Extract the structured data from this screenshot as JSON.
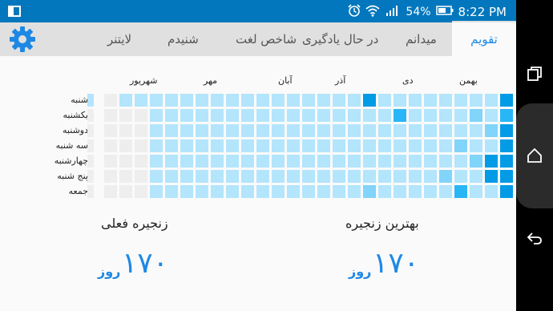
{
  "status_bar": {
    "battery": "54%",
    "time": "8:22 PM",
    "icons": [
      "screen-mirror-icon",
      "alarm-icon",
      "wifi-icon",
      "signal-icon",
      "battery-icon"
    ]
  },
  "nav_bar": {
    "icons": [
      "recents-icon",
      "home-icon",
      "back-icon"
    ]
  },
  "tabs": [
    "تقویم",
    "میدانم",
    "در حال یادگیری",
    "شاخص لغت",
    "شنیدم",
    "لایتنر"
  ],
  "active_tab": 0,
  "calendar": {
    "months": [
      "بهمن",
      "دی",
      "آذر",
      "آبان",
      "مهر",
      "شهریور"
    ],
    "days": [
      "شنبه",
      "یکشنبه",
      "دوشنبه",
      "سه شنبه",
      "چهارشنبه",
      "پنج شنبه",
      "جمعه"
    ],
    "colors": {
      "empty": "#eeeeee",
      "light": "#b3e5fc",
      "medium": "#81d4fa",
      "dark": "#29b6f6",
      "darkest": "#039be5"
    }
  },
  "stats": {
    "current_streak": {
      "label": "زنجیره فعلی",
      "value": "۱۷۰",
      "unit": "روز"
    },
    "best_streak": {
      "label": "بهترین زنجیره",
      "value": "۱۷۰",
      "unit": "روز"
    }
  }
}
